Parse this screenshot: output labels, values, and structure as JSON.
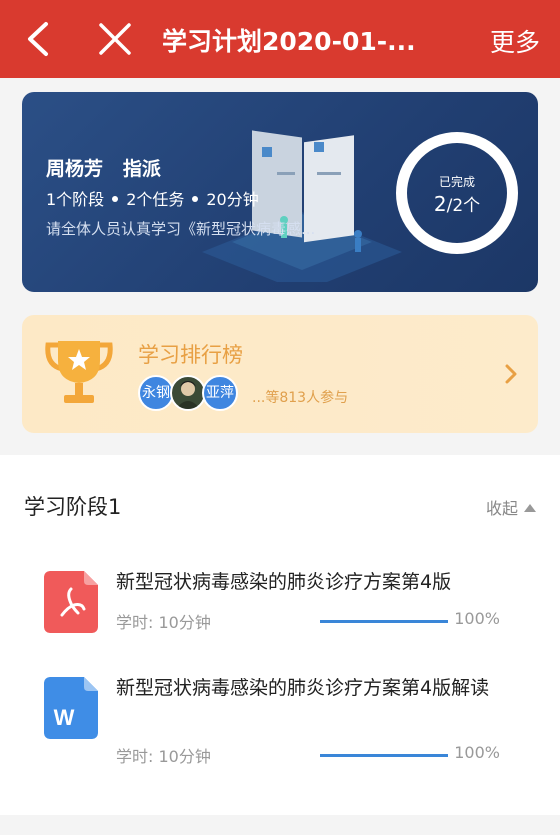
{
  "header": {
    "title": "学习计划2020-01-...",
    "more_label": "更多",
    "back_icon": "chevron-left-icon",
    "close_icon": "close-icon",
    "bg_color": "#d93a2f"
  },
  "plan": {
    "assigner": "周杨芳",
    "assign_label": "指派",
    "stages": "1个阶段",
    "tasks": "2个任务",
    "duration": "20分钟",
    "description": "请全体人员认真学习《新型冠状病毒感...",
    "completed_label": "已完成",
    "completed_count": "2",
    "completed_total": "/2个"
  },
  "leaderboard": {
    "title": "学习排行榜",
    "avatars": [
      {
        "text": "永钢"
      },
      {
        "text": ""
      },
      {
        "text": "亚萍"
      }
    ],
    "participants": "...等813人参与"
  },
  "stage": {
    "title": "学习阶段1",
    "collapse_label": "收起",
    "items": [
      {
        "title": "新型冠状病毒感染的肺炎诊疗方案第4版",
        "type": "pdf",
        "study_time": "学时: 10分钟",
        "progress_pct": "100%",
        "progress": 1.0
      },
      {
        "title": "新型冠状病毒感染的肺炎诊疗方案第4版解读",
        "type": "word",
        "icon_letter": "W",
        "study_time": "学时: 10分钟",
        "progress_pct": "100%",
        "progress": 1.0
      }
    ]
  }
}
